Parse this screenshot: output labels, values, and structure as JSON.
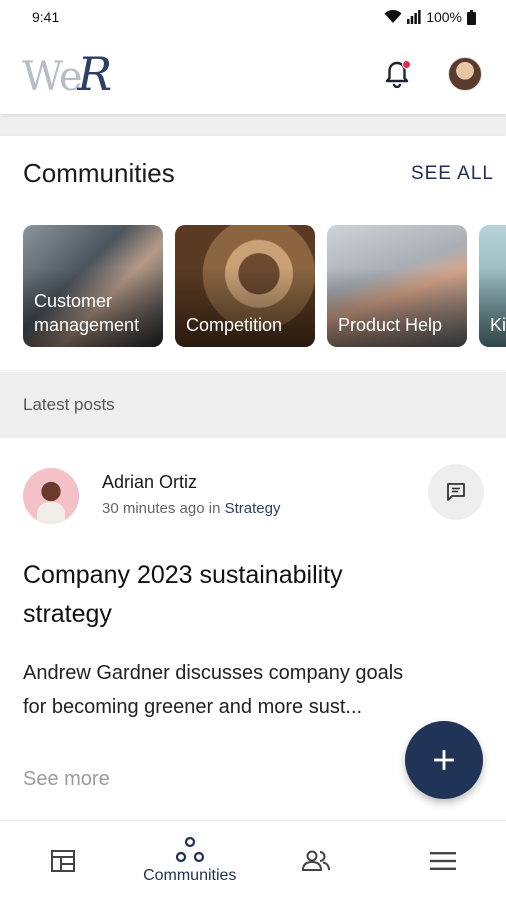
{
  "status_bar": {
    "time": "9:41",
    "battery": "100%"
  },
  "header": {
    "logo_part1": "We",
    "logo_part2": "R"
  },
  "communities": {
    "title": "Communities",
    "see_all": "SEE ALL",
    "items": [
      {
        "label": "Customer management"
      },
      {
        "label": "Competition"
      },
      {
        "label": "Product Help"
      },
      {
        "label": "Ki"
      }
    ]
  },
  "latest_posts": {
    "title": "Latest posts"
  },
  "post": {
    "author": "Adrian Ortiz",
    "time": "30 minutes ago",
    "in_word": "in",
    "community": "Strategy",
    "title": "Company 2023 sustainability strategy",
    "body": "Andrew Gardner discusses company goals for becoming greener and more sust...",
    "see_more": "See more"
  },
  "bottom_nav": {
    "items": [
      {
        "icon": "feed-icon",
        "label": ""
      },
      {
        "icon": "communities-icon",
        "label": "Communities"
      },
      {
        "icon": "people-icon",
        "label": ""
      },
      {
        "icon": "menu-icon",
        "label": ""
      }
    ]
  },
  "colors": {
    "brand": "#1f3457",
    "notification": "#e8294b"
  }
}
